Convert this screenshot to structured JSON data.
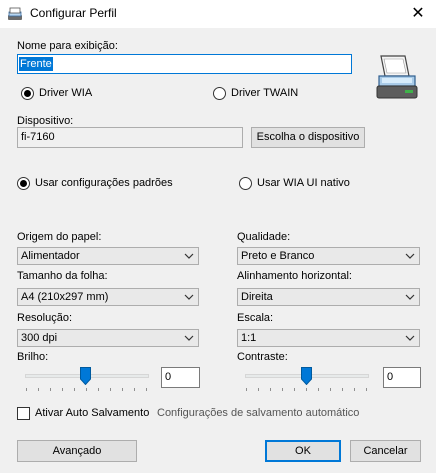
{
  "window": {
    "title": "Configurar Perfil",
    "close_glyph": "✕"
  },
  "display_name": {
    "label": "Nome para exibição:",
    "value": "Frente"
  },
  "driver": {
    "wia_label": "Driver WIA",
    "twain_label": "Driver TWAIN",
    "selected": "wia"
  },
  "device": {
    "label": "Dispositivo:",
    "value": "fi-7160",
    "choose_button": "Escolha o dispositivo"
  },
  "config_mode": {
    "default_label": "Usar configurações padrões",
    "native_label": "Usar WIA UI nativo",
    "selected": "default"
  },
  "paper_source": {
    "label": "Origem do papel:",
    "value": "Alimentador"
  },
  "quality": {
    "label": "Qualidade:",
    "value": "Preto e Branco"
  },
  "page_size": {
    "label": "Tamanho da folha:",
    "value": "A4 (210x297 mm)"
  },
  "h_align": {
    "label": "Alinhamento horizontal:",
    "value": "Direita"
  },
  "resolution": {
    "label": "Resolução:",
    "value": "300 dpi"
  },
  "scale": {
    "label": "Escala:",
    "value": "1:1"
  },
  "brightness": {
    "label": "Brilho:",
    "value": "0"
  },
  "contrast": {
    "label": "Contraste:",
    "value": "0"
  },
  "auto_save": {
    "label": "Ativar Auto Salvamento",
    "link": "Configurações de salvamento automático",
    "checked": false
  },
  "buttons": {
    "advanced": "Avançado",
    "ok": "OK",
    "cancel": "Cancelar"
  },
  "icons": {
    "app": "scanner-icon",
    "scanner": "scanner-icon"
  },
  "colors": {
    "accent": "#0078d7",
    "dialog_bg": "#f0f0f0"
  }
}
